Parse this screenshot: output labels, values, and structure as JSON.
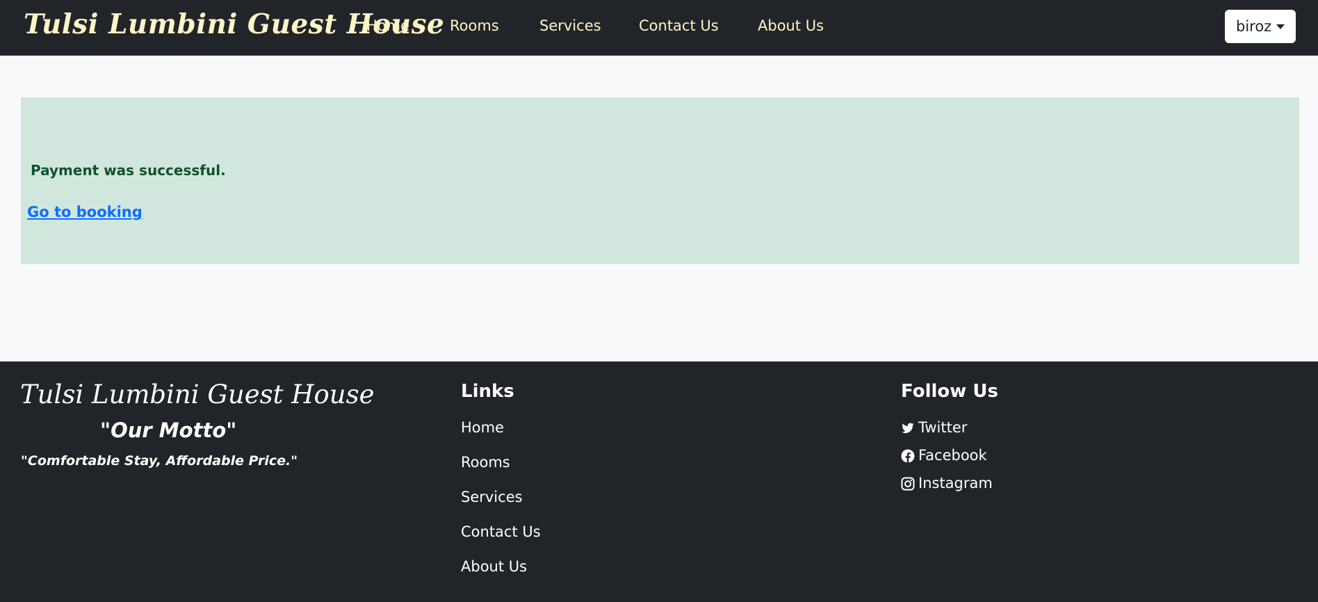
{
  "header": {
    "brand": "Tulsi Lumbini Guest House",
    "nav": [
      "Home",
      "Rooms",
      "Services",
      "Contact Us",
      "About Us"
    ],
    "user": {
      "label": "biroz"
    }
  },
  "alert": {
    "message": "Payment was successful.",
    "link": "Go to booking"
  },
  "footer": {
    "brand": "Tulsi Lumbini Guest House",
    "motto": "\"Our Motto\"",
    "tagline": "\"Comfortable Stay, Affordable Price.\"",
    "links_heading": "Links",
    "links": [
      "Home",
      "Rooms",
      "Services",
      "Contact Us",
      "About Us"
    ],
    "follow_heading": "Follow Us",
    "social": [
      {
        "label": "Twitter",
        "icon": "twitter-icon"
      },
      {
        "label": "Facebook",
        "icon": "facebook-icon"
      },
      {
        "label": "Instagram",
        "icon": "instagram-icon"
      }
    ]
  },
  "colors": {
    "navbar_bg": "#212529",
    "brand_text": "#fdf5c7",
    "alert_bg": "#d1e7dd",
    "alert_text": "#0f5132",
    "link": "#0d6efd",
    "page_bg": "#f8f9fa"
  }
}
